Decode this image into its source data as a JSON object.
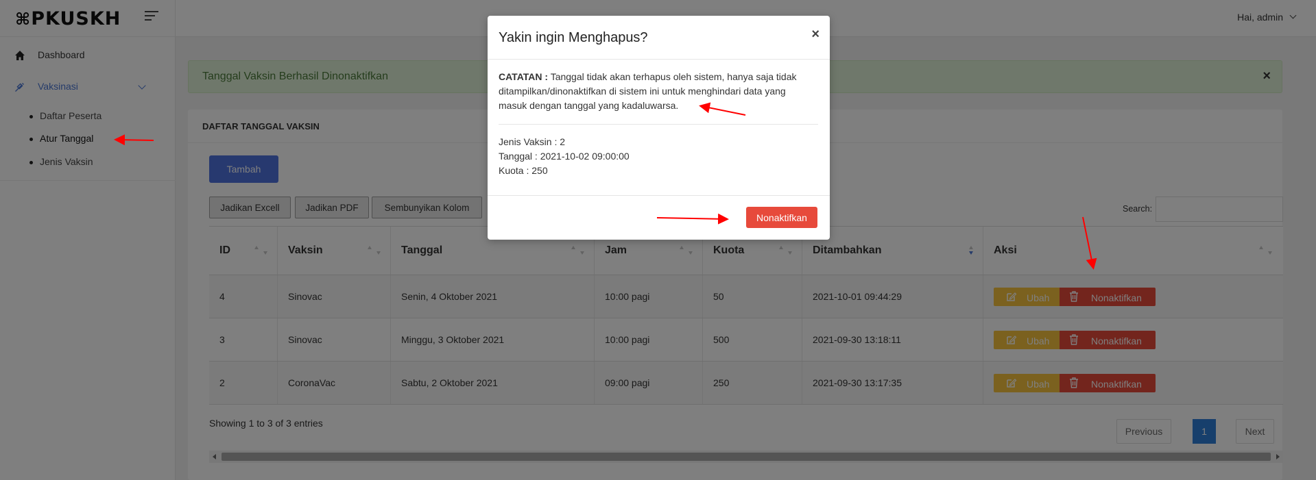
{
  "brand": {
    "logo_text": "PKUSKH"
  },
  "topbar": {
    "user_greeting": "Hai, admin"
  },
  "sidebar": {
    "dashboard": "Dashboard",
    "vaksinasi": "Vaksinasi",
    "sub_items": [
      "Daftar Peserta",
      "Atur Tanggal",
      "Jenis Vaksin"
    ]
  },
  "alert": {
    "message": "Tanggal Vaksin Berhasil Dinonaktifkan"
  },
  "card": {
    "title": "DAFTAR TANGGAL VAKSIN",
    "add_button": "Tambah",
    "export_buttons": [
      "Jadikan Excell",
      "Jadikan PDF",
      "Sembunyikan Kolom"
    ],
    "search_label": "Search:"
  },
  "table": {
    "headers": [
      "ID",
      "Vaksin",
      "Tanggal",
      "Jam",
      "Kuota",
      "Ditambahkan",
      "Aksi"
    ],
    "rows": [
      {
        "id": "4",
        "vaksin": "Sinovac",
        "tanggal": "Senin, 4 Oktober 2021",
        "jam": "10:00 pagi",
        "kuota": "50",
        "ditambahkan": "2021-10-01 09:44:29"
      },
      {
        "id": "3",
        "vaksin": "Sinovac",
        "tanggal": "Minggu, 3 Oktober 2021",
        "jam": "10:00 pagi",
        "kuota": "500",
        "ditambahkan": "2021-09-30 13:18:11"
      },
      {
        "id": "2",
        "vaksin": "CoronaVac",
        "tanggal": "Sabtu, 2 Oktober 2021",
        "jam": "09:00 pagi",
        "kuota": "250",
        "ditambahkan": "2021-09-30 13:17:35"
      }
    ],
    "edit_label": "Ubah",
    "deactivate_label": "Nonaktifkan"
  },
  "footer": {
    "showing": "Showing 1 to 3 of 3 entries",
    "previous": "Previous",
    "current_page": "1",
    "next": "Next"
  },
  "modal": {
    "title": "Yakin ingin Menghapus?",
    "close": "×",
    "note_label": "CATATAN :",
    "note_text": "Tanggal tidak akan terhapus oleh sistem, hanya saja tidak ditampilkan/dinonaktifkan di sistem ini untuk menghindari data yang masuk dengan tanggal yang kadaluwarsa.",
    "jenis_vaksin": "Jenis Vaksin : 2",
    "tanggal": "Tanggal : 2021-10-02 09:00:00",
    "kuota": "Kuota : 250",
    "confirm_button": "Nonaktifkan"
  },
  "colors": {
    "primary": "#4e73df",
    "danger": "#e74a3b",
    "warning": "#f6c23e",
    "success_bg": "#dff1d6",
    "annotation_arrow": "#ff0000"
  },
  "icons": [
    "home-icon",
    "syringe-icon",
    "menu-icon",
    "chevron-down-icon",
    "close-icon",
    "edit-icon",
    "trash-icon",
    "sort-icon"
  ]
}
